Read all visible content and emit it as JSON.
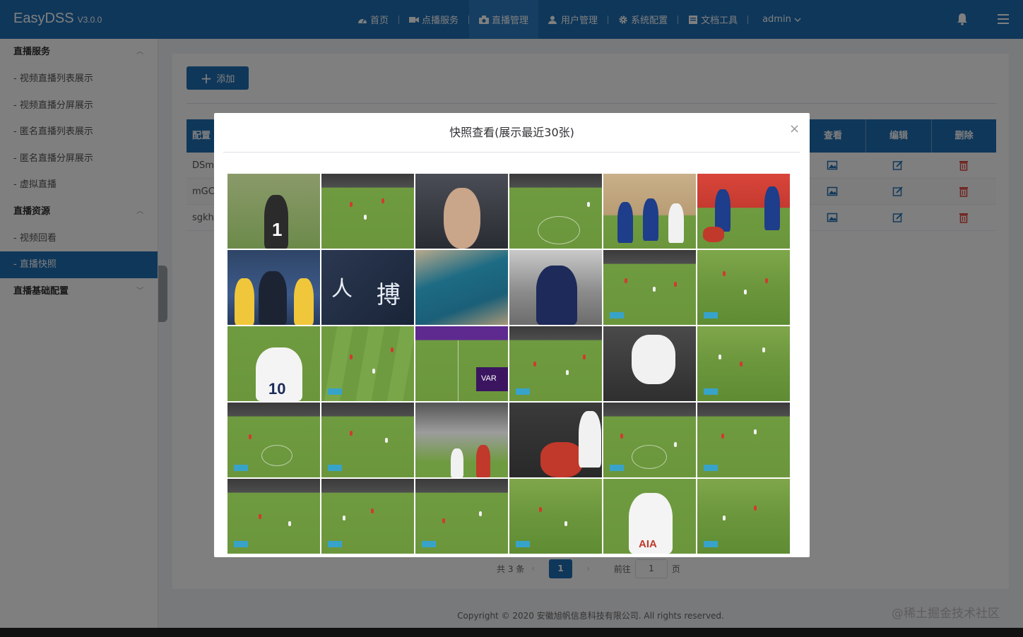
{
  "header": {
    "app_name": "EasyDSS",
    "version": "V3.0.0",
    "nav": [
      {
        "label": "首页",
        "icon": "dashboard-icon",
        "active": false
      },
      {
        "label": "点播服务",
        "icon": "video-camera-icon",
        "active": false
      },
      {
        "label": "直播管理",
        "icon": "live-camera-icon",
        "active": true
      },
      {
        "label": "用户管理",
        "icon": "user-icon",
        "active": false
      },
      {
        "label": "系统配置",
        "icon": "gear-icon",
        "active": false
      },
      {
        "label": "文档工具",
        "icon": "document-icon",
        "active": false
      }
    ],
    "user": "admin",
    "user_icon": "chevron-down-icon",
    "bell_icon": "bell-icon",
    "menu_icon": "hamburger-icon"
  },
  "sidebar": {
    "groups": [
      {
        "label": "直播服务",
        "expanded": true,
        "items": [
          {
            "label": "- 视频直播列表展示",
            "active": false
          },
          {
            "label": "- 视频直播分屏展示",
            "active": false
          },
          {
            "label": "- 匿名直播列表展示",
            "active": false
          },
          {
            "label": "- 匿名直播分屏展示",
            "active": false
          },
          {
            "label": "- 虚拟直播",
            "active": false
          }
        ]
      },
      {
        "label": "直播资源",
        "expanded": true,
        "items": [
          {
            "label": "- 视频回看",
            "active": false
          },
          {
            "label": "- 直播快照",
            "active": true
          }
        ]
      },
      {
        "label": "直播基础配置",
        "expanded": false,
        "items": []
      }
    ]
  },
  "main": {
    "add_button": "添加",
    "table": {
      "headers": {
        "name": "配置",
        "view": "查看",
        "edit": "编辑",
        "delete": "删除"
      },
      "rows": [
        {
          "name": "DSm"
        },
        {
          "name": "mGC"
        },
        {
          "name": "sgkh"
        }
      ]
    },
    "pagination": {
      "total": "共 3 条",
      "current_page": "1",
      "goto_label": "前往",
      "goto_value": "1",
      "page_unit": "页"
    }
  },
  "footer": {
    "copyright": "Copyright © 2020 安徽旭帆信息科技有限公司. All rights reserved.",
    "watermark": "@稀土掘金技术社区"
  },
  "modal": {
    "title": "快照查看(展示最近30张)",
    "close_symbol": "×",
    "snapshots": [
      {
        "kind": "goalkeeper"
      },
      {
        "kind": "pitch"
      },
      {
        "kind": "crowd-close"
      },
      {
        "kind": "pitch"
      },
      {
        "kind": "crowd-red"
      },
      {
        "kind": "crowd-red"
      },
      {
        "kind": "blue-team"
      },
      {
        "kind": "calligraphy"
      },
      {
        "kind": "coastline"
      },
      {
        "kind": "blue-player"
      },
      {
        "kind": "pitch"
      },
      {
        "kind": "pitch"
      },
      {
        "kind": "white-shirt"
      },
      {
        "kind": "pitch"
      },
      {
        "kind": "var-screen"
      },
      {
        "kind": "pitch"
      },
      {
        "kind": "player-bend"
      },
      {
        "kind": "pitch"
      },
      {
        "kind": "stand-pitch"
      },
      {
        "kind": "stand-pitch"
      },
      {
        "kind": "goal-net"
      },
      {
        "kind": "player-down"
      },
      {
        "kind": "stand-pitch"
      },
      {
        "kind": "stand-pitch"
      },
      {
        "kind": "stand-pitch"
      },
      {
        "kind": "stand-pitch"
      },
      {
        "kind": "stand-pitch"
      },
      {
        "kind": "pitch"
      },
      {
        "kind": "player-aia"
      },
      {
        "kind": "pitch"
      }
    ]
  },
  "colors": {
    "primary": "#1f6fb5",
    "delete": "#e0443a",
    "overlay": "rgba(0,0,0,0.5)"
  }
}
